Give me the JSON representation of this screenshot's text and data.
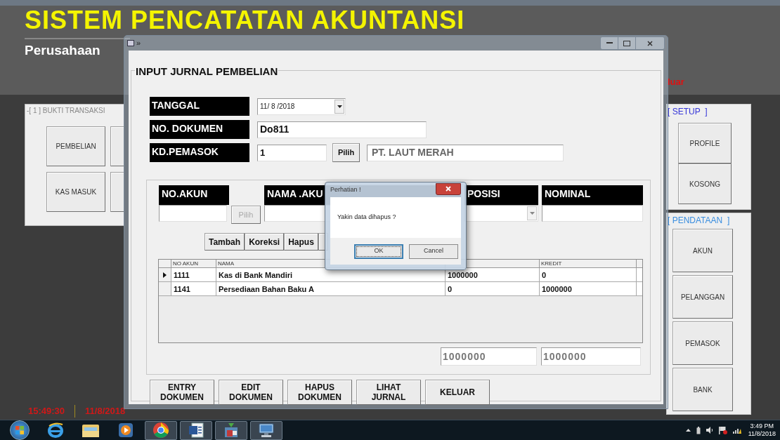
{
  "app": {
    "title": "SISTEM PENCATATAN AKUNTANSI",
    "subtitle": "Perusahaan",
    "exit_link": "luar",
    "clock": "15:49:30",
    "date": "11/8/2018"
  },
  "left_panel": {
    "title": "-[ 1 ] BUKTI TRANSAKSI",
    "buttons": [
      "PEMBELIAN",
      "KAS MASUK"
    ]
  },
  "setup_panel": {
    "title": "[ SETUP  ]",
    "buttons": [
      "PROFILE",
      "KOSONG"
    ]
  },
  "data_panel": {
    "title": "[ PENDATAAN  ]",
    "buttons": [
      "AKUN",
      "PELANGGAN",
      "PEMASOK",
      "BANK"
    ]
  },
  "window": {
    "title": "»",
    "form": {
      "title": "INPUT JURNAL PEMBELIAN",
      "fields": [
        {
          "label": "TANGGAL",
          "kind": "date",
          "value": "11/ 8 /2018"
        },
        {
          "label": "NO. DOKUMEN",
          "kind": "text",
          "value": "Do811"
        },
        {
          "label": "KD.PEMASOK",
          "kind": "lookup",
          "value": "1",
          "button": "Pilih",
          "name": "PT. LAUT MERAH"
        }
      ],
      "entry_columns": [
        {
          "label": "NO.AKUN",
          "kind": "lookup",
          "button": "Pilih",
          "disabled": true
        },
        {
          "label": "NAMA .AKU",
          "kind": "text"
        },
        {
          "label": "POSISI",
          "kind": "combo"
        },
        {
          "label": "NOMINAL",
          "kind": "text"
        }
      ],
      "row_buttons": [
        "Tambah",
        "Koreksi",
        "Hapus"
      ],
      "grid": {
        "columns": [
          {
            "kind": "label",
            "label": "NO AKUN"
          },
          {
            "kind": "label",
            "label": "NAMA"
          },
          {
            "kind": "covered"
          },
          {
            "kind": "label",
            "label": "KREDIT"
          }
        ],
        "rows": [
          {
            "selected": true,
            "cells": [
              "1111",
              "Kas di Bank Mandiri",
              "1000000",
              "0"
            ]
          },
          {
            "selected": false,
            "cells": [
              "1141",
              "Persediaan Bahan Baku A",
              "0",
              "1000000"
            ]
          }
        ]
      },
      "totals": [
        "1000000",
        "1000000"
      ],
      "actions": [
        "ENTRY DOKUMEN",
        "EDIT DOKUMEN",
        "HAPUS DOKUMEN",
        "LIHAT JURNAL",
        "KELUAR"
      ]
    }
  },
  "dialog": {
    "title": "Perhatian !",
    "message": "Yakin data dihapus ?",
    "buttons": [
      {
        "label": "OK",
        "focused": true
      },
      {
        "label": "Cancel",
        "focused": false
      }
    ]
  },
  "taskbar": {
    "apps": [
      {
        "kind": "ie",
        "running": false
      },
      {
        "kind": "folder",
        "running": false
      },
      {
        "kind": "media",
        "running": false
      },
      {
        "kind": "chrome",
        "running": true
      },
      {
        "kind": "word",
        "running": true
      },
      {
        "kind": "app",
        "running": true
      },
      {
        "kind": "monitor",
        "running": true
      }
    ],
    "time": "3:49 PM",
    "date": "11/8/2018"
  }
}
